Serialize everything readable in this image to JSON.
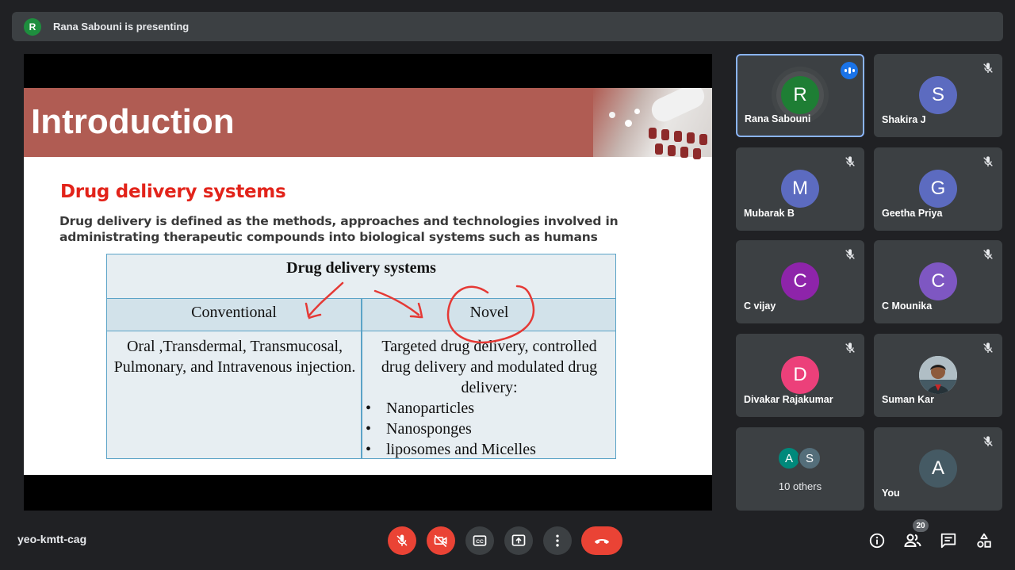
{
  "presenting": {
    "avatar_letter": "R",
    "text": "Rana Sabouni is presenting"
  },
  "slide": {
    "title": "Introduction",
    "subtitle": "Drug delivery systems",
    "paragraph": "Drug delivery is defined as the methods, approaches and technologies involved in administrating therapeutic compounds into biological systems such as humans",
    "table": {
      "header": "Drug delivery systems",
      "col1": "Conventional",
      "col2": "Novel",
      "col1_body": "Oral ,Transdermal, Transmucosal, Pulmonary, and Intravenous injection.",
      "col2_body": "Targeted drug delivery, controlled drug delivery and modulated drug delivery:",
      "bullets": [
        "Nanoparticles",
        "Nanosponges",
        "liposomes and Micelles"
      ]
    }
  },
  "participants": [
    {
      "name": "Rana Sabouni",
      "letter": "R",
      "color": "#1e7e34",
      "speaking": true
    },
    {
      "name": "Shakira J",
      "letter": "S",
      "color": "#5c6bc0",
      "muted": true
    },
    {
      "name": "Mubarak B",
      "letter": "M",
      "color": "#5c6bc0",
      "muted": true
    },
    {
      "name": "Geetha Priya",
      "letter": "G",
      "color": "#5c6bc0",
      "muted": true
    },
    {
      "name": "C vijay",
      "letter": "C",
      "color": "#8e24aa",
      "muted": true
    },
    {
      "name": "C Mounika",
      "letter": "C",
      "color": "#7e57c2",
      "muted": true
    },
    {
      "name": "Divakar Rajakumar",
      "letter": "D",
      "color": "#ec407a",
      "muted": true
    },
    {
      "name": "Suman Kar",
      "letter": "",
      "color": "#a1887f",
      "muted": true
    },
    {
      "name": "You",
      "letter": "A",
      "color": "#455a64",
      "muted": true
    }
  ],
  "others": {
    "label": "10 others",
    "letters": [
      "A",
      "S"
    ],
    "colors": [
      "#00897b",
      "#546e7a"
    ]
  },
  "meeting_code": "yeo-kmtt-cag",
  "participant_count": "20",
  "icons": {
    "mic": "mic-off-icon",
    "camera": "camera-off-icon",
    "captions": "captions-icon",
    "present": "present-screen-icon",
    "more": "more-vert-icon",
    "end": "call-end-icon",
    "info": "info-icon",
    "people": "people-icon",
    "chat": "chat-icon",
    "activities": "activities-icon"
  }
}
